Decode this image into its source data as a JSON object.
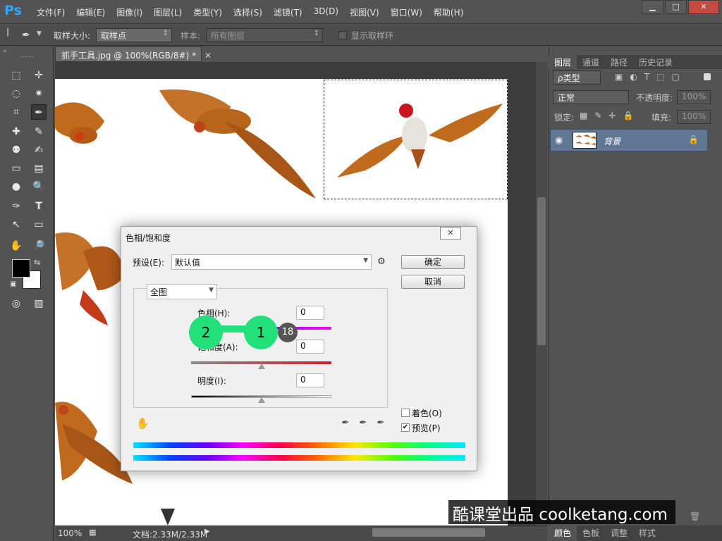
{
  "app": {
    "logo": "Ps"
  },
  "menubar": {
    "items": [
      "文件(F)",
      "编辑(E)",
      "图像(I)",
      "图层(L)",
      "类型(Y)",
      "选择(S)",
      "滤镜(T)",
      "3D(D)",
      "视图(V)",
      "窗口(W)",
      "帮助(H)"
    ]
  },
  "options": {
    "sample_size_label": "取样大小:",
    "sample_size_value": "取样点",
    "sample_label": "样本:",
    "sample_value": "所有图层",
    "show_ring_label": "显示取样环"
  },
  "document": {
    "tab_title": "抓手工具.jpg @ 100%(RGB/8#) *",
    "zoom": "100%",
    "doc_size": "文档:2.33M/2.33M"
  },
  "layers_panel": {
    "tabs": [
      "图层",
      "通道",
      "路径",
      "历史记录"
    ],
    "kind_filter": "ρ类型",
    "blend_mode": "正常",
    "opacity_label": "不透明度:",
    "opacity_value": "100%",
    "lock_label": "锁定:",
    "fill_label": "填充:",
    "fill_value": "100%",
    "layer_name": "背景",
    "bottom_tabs": [
      "颜色",
      "色板",
      "调整",
      "样式"
    ]
  },
  "dialog": {
    "title": "色相/饱和度",
    "preset_label": "预设(E):",
    "preset_value": "默认值",
    "ok_label": "确定",
    "cancel_label": "取消",
    "channel_value": "全图",
    "hue_label": "色相(H):",
    "hue_value": "0",
    "saturation_label": "饱和度(A):",
    "saturation_value": "0",
    "lightness_label": "明度(I):",
    "lightness_value": "0",
    "colorize_label": "着色(O)",
    "preview_label": "预览(P)",
    "preview_checked": true,
    "hue_slider_level": 0.5,
    "saturation_slider_level": 0.5,
    "lightness_slider_level": 0.5
  },
  "markers": {
    "first": "1",
    "second": "2",
    "step": "18"
  },
  "watermark": "酷课堂出品 coolketang.com",
  "colors": {
    "accent": "#31a8ff",
    "marker": "#22e07a",
    "layer_selected": "#5f7793"
  }
}
